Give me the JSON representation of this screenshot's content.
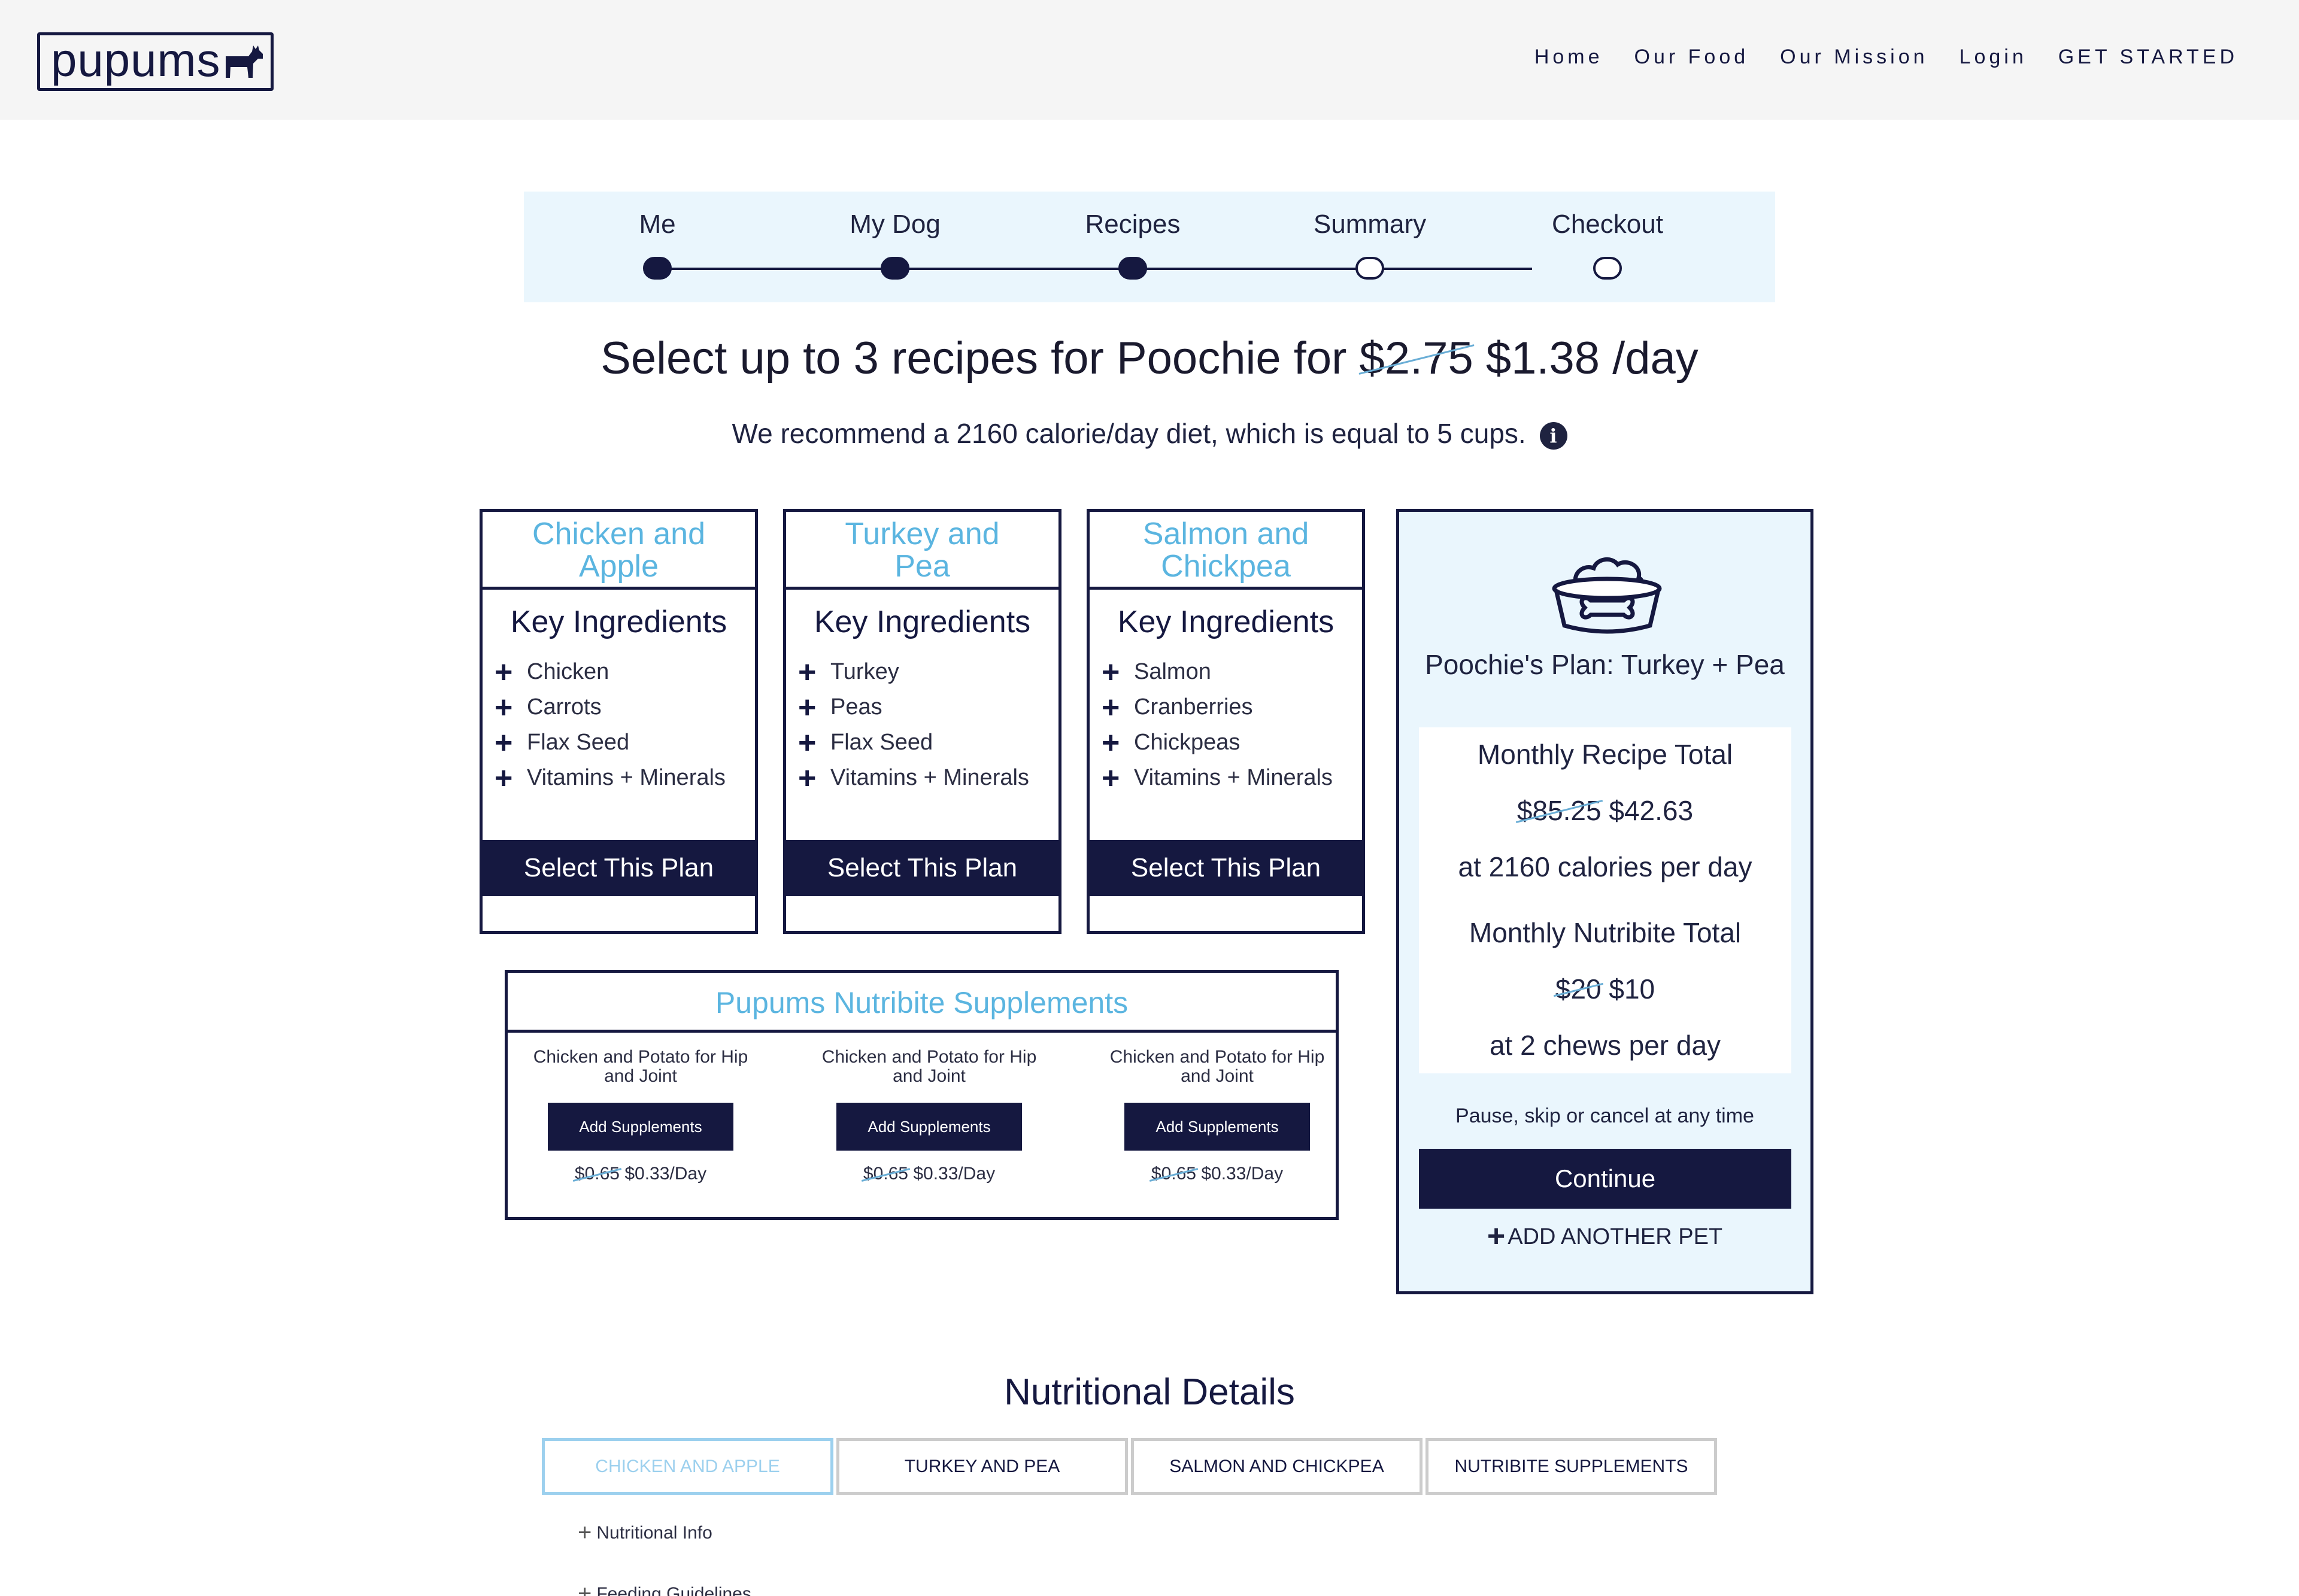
{
  "header": {
    "logo_text": "pupums",
    "nav": [
      "Home",
      "Our Food",
      "Our Mission",
      "Login",
      "GET STARTED"
    ]
  },
  "progress": {
    "steps": [
      "Me",
      "My Dog",
      "Recipes",
      "Summary",
      "Checkout"
    ],
    "completed_count": 3
  },
  "headline": {
    "prefix": "Select up to 3 recipes for Poochie for",
    "old_price": "$2.75",
    "new_price": "$1.38 /day"
  },
  "subline": {
    "text": "We recommend a 2160 calorie/day diet, which is equal to 5 cups.",
    "info_icon": "info-circle-icon"
  },
  "recipes": [
    {
      "title_line1": "Chicken and",
      "title_line2": "Apple",
      "key_title": "Key Ingredients",
      "ingredients": [
        "Chicken",
        "Carrots",
        "Flax Seed",
        "Vitamins + Minerals"
      ],
      "button": "Select This Plan"
    },
    {
      "title_line1": "Turkey and",
      "title_line2": "Pea",
      "key_title": "Key Ingredients",
      "ingredients": [
        "Turkey",
        "Peas",
        "Flax Seed",
        "Vitamins + Minerals"
      ],
      "button": "Select This Plan"
    },
    {
      "title_line1": "Salmon and",
      "title_line2": "Chickpea",
      "key_title": "Key Ingredients",
      "ingredients": [
        "Salmon",
        "Cranberries",
        "Chickpeas",
        "Vitamins + Minerals"
      ],
      "button": "Select This Plan"
    }
  ],
  "supplements": {
    "title": "Pupums Nutribite Supplements",
    "items": [
      {
        "name_line1": "Chicken and Potato for Hip",
        "name_line2": "and Joint",
        "button": "Add Supplements",
        "old_price": "$0.65",
        "new_price": "$0.33/Day"
      },
      {
        "name_line1": "Chicken and Potato for Hip",
        "name_line2": "and Joint",
        "button": "Add Supplements",
        "old_price": "$0.65",
        "new_price": "$0.33/Day"
      },
      {
        "name_line1": "Chicken and Potato for Hip",
        "name_line2": "and Joint",
        "button": "Add Supplements",
        "old_price": "$0.65",
        "new_price": "$0.33/Day"
      }
    ]
  },
  "plan": {
    "icon": "dog-bowl-icon",
    "name": "Poochie's Plan: Turkey + Pea",
    "recipe_total_label": "Monthly Recipe Total",
    "recipe_old": "$85.25",
    "recipe_new": "$42.63",
    "recipe_note": "at 2160 calories per day",
    "nutribite_label": "Monthly Nutribite Total",
    "nutribite_old": "$20",
    "nutribite_new": "$10",
    "nutribite_note": "at 2 chews per day",
    "pause_text": "Pause, skip or cancel at any time",
    "continue": "Continue",
    "add_pet": "ADD ANOTHER PET"
  },
  "nutrition": {
    "title": "Nutritional Details",
    "tabs": [
      "CHICKEN AND APPLE",
      "TURKEY AND PEA",
      "SALMON AND CHICKPEA",
      "NUTRIBITE SUPPLEMENTS"
    ],
    "active_tab": 0,
    "accordions": [
      "Nutritional Info",
      "Feeding Guidelines"
    ]
  },
  "colors": {
    "navy": "#151840",
    "accent_blue": "#5bb5e0",
    "panel_bg": "#eaf6fd"
  }
}
